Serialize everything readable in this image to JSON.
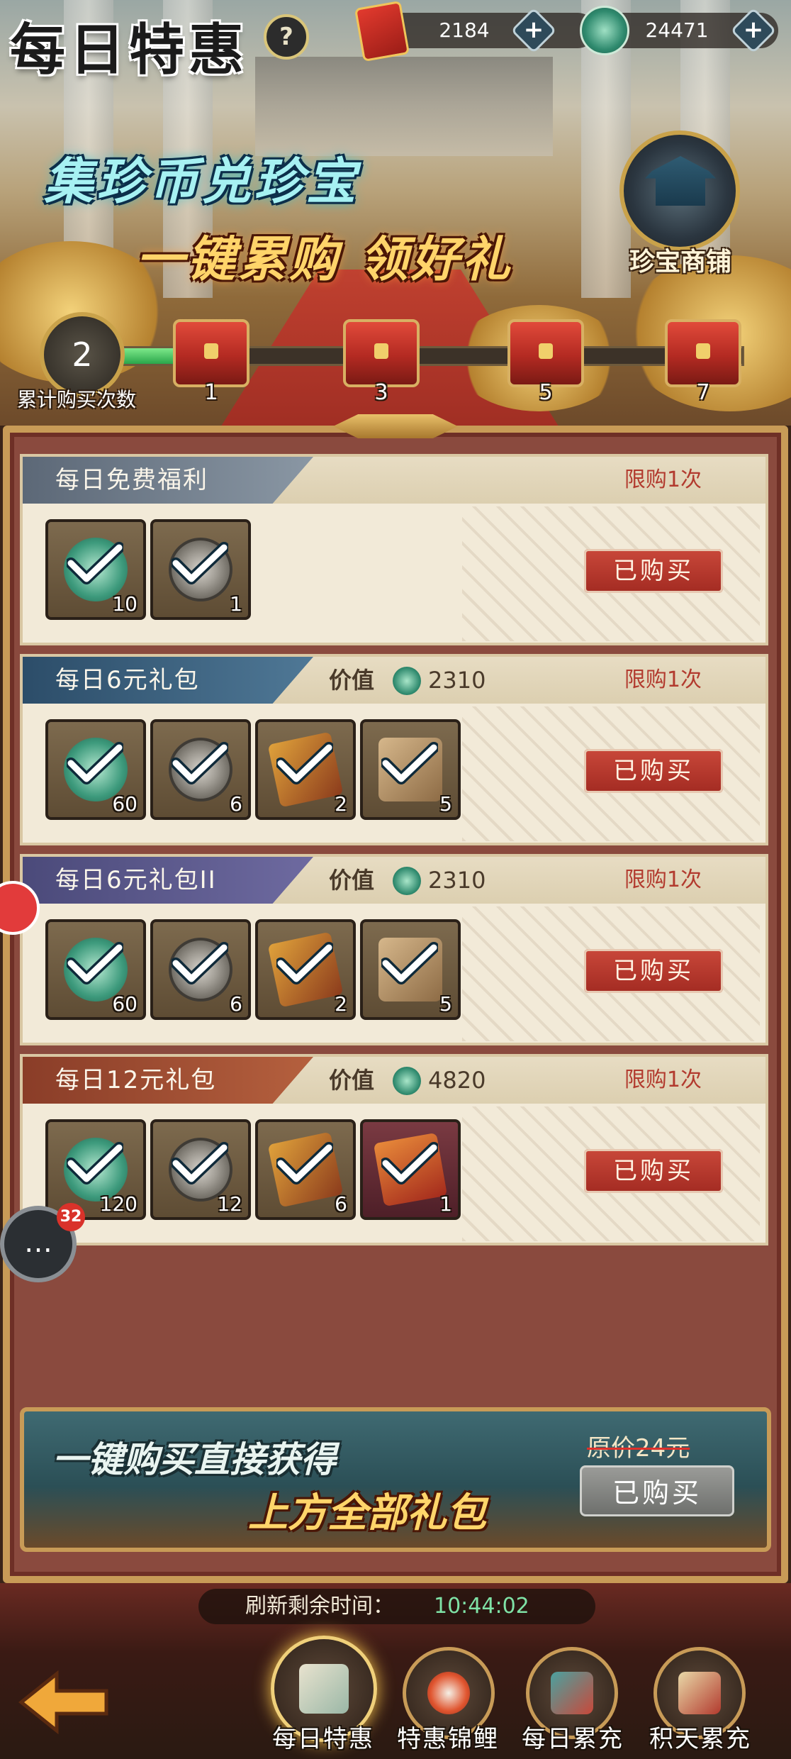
{
  "header": {
    "title": "每日特惠",
    "help_label": "?",
    "currencies": [
      {
        "icon": "red-envelope-icon",
        "value": "2184"
      },
      {
        "icon": "jade-coin-icon",
        "value": "24471"
      }
    ]
  },
  "banner": {
    "line1": "集珍币兑珍宝",
    "line2": "一键累购 领好礼",
    "shop_label": "珍宝商铺",
    "purchase_count": "2",
    "purchase_count_label": "累计购买次数",
    "progress_fraction": 0.14,
    "milestones": [
      "1",
      "3",
      "5",
      "7"
    ]
  },
  "packs": [
    {
      "title": "每日免费福利",
      "value_label": "",
      "value": "",
      "limit": "限购1次",
      "button": "已购买",
      "items": [
        {
          "icon": "jade-icon",
          "qty": "10",
          "checked": true
        },
        {
          "icon": "coin-icon",
          "qty": "1",
          "checked": true
        }
      ]
    },
    {
      "title": "每日6元礼包",
      "value_label": "价值",
      "value": "2310",
      "limit": "限购1次",
      "button": "已购买",
      "items": [
        {
          "icon": "jade-icon",
          "qty": "60",
          "checked": true
        },
        {
          "icon": "coin-icon",
          "qty": "6",
          "checked": true
        },
        {
          "icon": "scroll-icon",
          "qty": "2",
          "checked": true
        },
        {
          "icon": "puzzle-icon",
          "qty": "5",
          "checked": true
        }
      ]
    },
    {
      "title": "每日6元礼包II",
      "value_label": "价值",
      "value": "2310",
      "limit": "限购1次",
      "button": "已购买",
      "items": [
        {
          "icon": "jade-icon",
          "qty": "60",
          "checked": true
        },
        {
          "icon": "coin-icon",
          "qty": "6",
          "checked": true
        },
        {
          "icon": "scroll-icon",
          "qty": "2",
          "checked": true
        },
        {
          "icon": "puzzle-icon",
          "qty": "5",
          "checked": true
        }
      ]
    },
    {
      "title": "每日12元礼包",
      "value_label": "价值",
      "value": "4820",
      "limit": "限购1次",
      "button": "已购买",
      "items": [
        {
          "icon": "jade-icon",
          "qty": "120",
          "checked": true
        },
        {
          "icon": "coin-icon",
          "qty": "12",
          "checked": true
        },
        {
          "icon": "scroll-icon",
          "qty": "6",
          "checked": true
        },
        {
          "icon": "hongbao-icon",
          "qty": "1",
          "checked": true
        }
      ]
    }
  ],
  "promo": {
    "line1": "一键购买直接获得",
    "line2": "上方全部礼包",
    "original_price": "原价24元",
    "button": "已购买"
  },
  "side": {
    "chat_badge": "32"
  },
  "footer": {
    "timer_label": "刷新剩余时间：",
    "timer_value": "10:44:02",
    "tabs": [
      {
        "label": "每日特惠",
        "active": true
      },
      {
        "label": "特惠锦鲤",
        "active": false
      },
      {
        "label": "每日累充",
        "active": false
      },
      {
        "label": "积天累充",
        "active": false
      }
    ]
  },
  "colors": {
    "accent_gold": "#c89b57",
    "button_red": "#b8382c",
    "button_gray": "#8a8b88",
    "timer_green": "#7fe2a6"
  }
}
